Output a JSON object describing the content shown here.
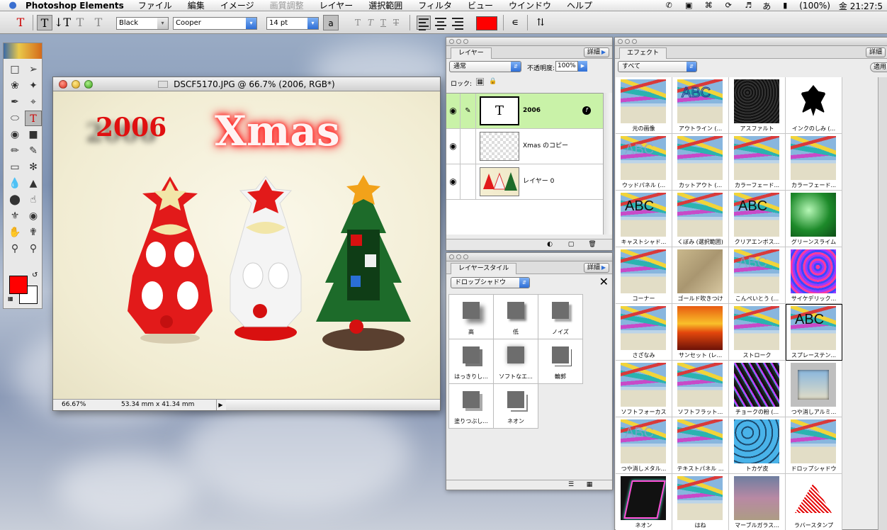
{
  "menubar": {
    "app_name": "Photoshop Elements",
    "items": [
      {
        "label": "ファイル",
        "disabled": false
      },
      {
        "label": "編集",
        "disabled": false
      },
      {
        "label": "イメージ",
        "disabled": false
      },
      {
        "label": "画質調整",
        "disabled": true
      },
      {
        "label": "レイヤー",
        "disabled": false
      },
      {
        "label": "選択範囲",
        "disabled": false
      },
      {
        "label": "フィルタ",
        "disabled": false
      },
      {
        "label": "ビュー",
        "disabled": false
      },
      {
        "label": "ウインドウ",
        "disabled": false
      },
      {
        "label": "ヘルプ",
        "disabled": false
      }
    ],
    "input_method": "あ",
    "battery": "(100%)",
    "clock": "金 21:27:5"
  },
  "options": {
    "tool_glyph": "T",
    "color_name": "Black",
    "font_family": "Cooper",
    "font_size": "14 pt",
    "aa_label": "a",
    "text_color": "#ff0000"
  },
  "document": {
    "title": "DSCF5170.JPG @ 66.7% (2006, RGB*)",
    "text_2006": "2006",
    "text_xmas": "Xmas",
    "zoom": "66.67%",
    "dimensions": "53.34 mm x 41.34 mm"
  },
  "layers_palette": {
    "tab": "レイヤー",
    "detail": "詳細",
    "blend_mode": "通常",
    "opacity_label": "不透明度:",
    "opacity": "100%",
    "lock_label": "ロック:",
    "layers": [
      {
        "name": "2006"
      },
      {
        "name": "Xmas のコピー"
      },
      {
        "name": "レイヤー 0"
      }
    ]
  },
  "styles_palette": {
    "tab": "レイヤースタイル",
    "detail": "詳細",
    "category": "ドロップシャドウ",
    "items": [
      "高",
      "低",
      "ノイズ",
      "はっきりし...",
      "ソフトなエ...",
      "輪郭",
      "塗りつぶし...",
      "ネオン"
    ]
  },
  "effects_palette": {
    "tab": "エフェクト",
    "detail": "詳細",
    "filter": "すべて",
    "apply_button": "適用",
    "items": [
      {
        "label": "元の画像",
        "style": "beach",
        "abc": ""
      },
      {
        "label": "アウトライン (...",
        "style": "beach",
        "abc": "ABC"
      },
      {
        "label": "アスファルト",
        "style": "dark",
        "abc": ""
      },
      {
        "label": "インクのしみ (...",
        "style": "ink",
        "abc": ""
      },
      {
        "label": "ウッドパネル (...",
        "style": "beach",
        "abc": "ABC"
      },
      {
        "label": "カットアウト (...",
        "style": "beach",
        "abc": ""
      },
      {
        "label": "カラーフェード...",
        "style": "beach",
        "abc": ""
      },
      {
        "label": "カラーフェード...",
        "style": "beach",
        "abc": ""
      },
      {
        "label": "キャストシャド...",
        "style": "beach",
        "abc": "ABC"
      },
      {
        "label": "くぼみ (選択範囲)",
        "style": "beach",
        "abc": ""
      },
      {
        "label": "クリアエンボス...",
        "style": "beach",
        "abc": "ABC"
      },
      {
        "label": "グリーンスライム",
        "style": "green",
        "abc": ""
      },
      {
        "label": "コーナー",
        "style": "beach",
        "abc": ""
      },
      {
        "label": "ゴールド吹きつけ",
        "style": "gold",
        "abc": ""
      },
      {
        "label": "こんぺいとう (...",
        "style": "beach",
        "abc": "ABC"
      },
      {
        "label": "サイケデリック...",
        "style": "psy",
        "abc": ""
      },
      {
        "label": "さざなみ",
        "style": "beach",
        "abc": ""
      },
      {
        "label": "サンセット (レ...",
        "style": "sunset",
        "abc": ""
      },
      {
        "label": "ストローク",
        "style": "beach",
        "abc": ""
      },
      {
        "label": "スプレーステン...",
        "style": "beach",
        "abc": "ABC",
        "selected": true
      },
      {
        "label": "ソフトフォーカス",
        "style": "beach",
        "abc": ""
      },
      {
        "label": "ソフトフラット...",
        "style": "beach",
        "abc": ""
      },
      {
        "label": "チョークの粉 (...",
        "style": "chalk",
        "abc": ""
      },
      {
        "label": "つや消しアルミ...",
        "style": "frame",
        "abc": ""
      },
      {
        "label": "つや消しメタル...",
        "style": "beach",
        "abc": "ABC"
      },
      {
        "label": "テキストパネル ...",
        "style": "beach",
        "abc": ""
      },
      {
        "label": "トカゲ皮",
        "style": "lizard",
        "abc": ""
      },
      {
        "label": "ドロップシャドウ",
        "style": "beach",
        "abc": ""
      },
      {
        "label": "ネオン",
        "style": "neon",
        "abc": ""
      },
      {
        "label": "はね",
        "style": "beach",
        "abc": ""
      },
      {
        "label": "マーブルガラス...",
        "style": "glass",
        "abc": ""
      },
      {
        "label": "ラバースタンプ",
        "style": "stamp",
        "abc": ""
      }
    ]
  }
}
